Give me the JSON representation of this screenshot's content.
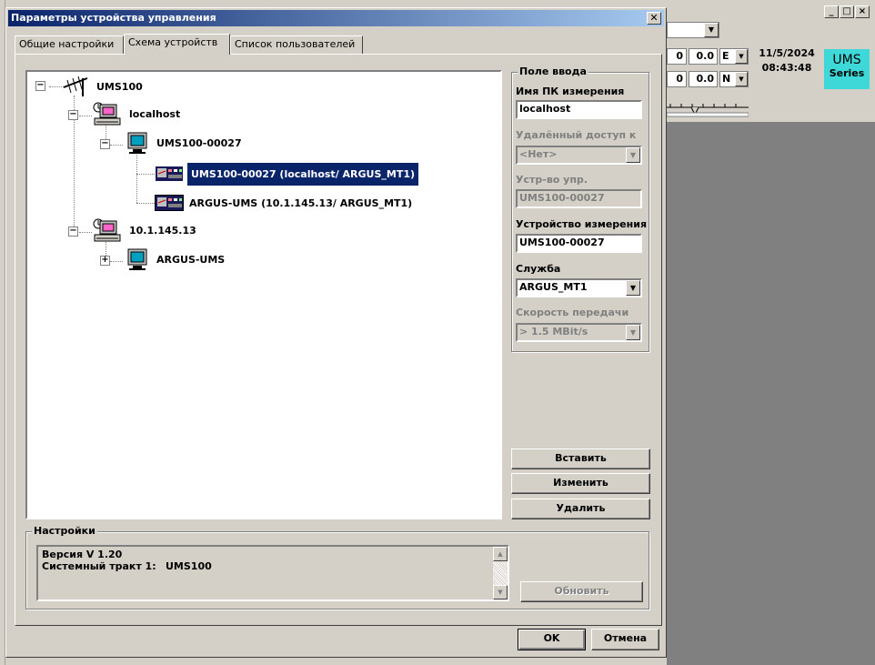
{
  "dialog": {
    "title": "Параметры устройства управления",
    "close_glyph": "✕"
  },
  "tabs": [
    {
      "label": "Общие настройки"
    },
    {
      "label": "Схема устройств"
    },
    {
      "label": "Список пользователей"
    }
  ],
  "tree": {
    "root": "UMS100",
    "host1": "localhost",
    "device1": "UMS100-00027",
    "service1": "UMS100-00027 (localhost/ ARGUS_MT1)",
    "service2": "ARGUS-UMS (10.1.145.13/ ARGUS_MT1)",
    "host2": "10.1.145.13",
    "device2": "ARGUS-UMS",
    "collapse_glyph": "−",
    "expand_glyph": "+"
  },
  "input_group": {
    "legend": "Поле ввода",
    "pc_name_label": "Имя ПК измерения",
    "pc_name_value": "localhost",
    "remote_label": "Удалённый доступ к",
    "remote_value": "<Нет>",
    "control_dev_label": "Устр-во упр.",
    "control_dev_value": "UMS100-00027",
    "meas_dev_label": "Устройство измерения",
    "meas_dev_value": "UMS100-00027",
    "service_label": "Служба",
    "service_value": "ARGUS_MT1",
    "speed_label": "Скорость передачи",
    "speed_value": "> 1.5 MBit/s"
  },
  "buttons": {
    "insert": "Вставить",
    "change": "Изменить",
    "delete": "Удалить",
    "refresh": "Обновить",
    "ok": "OK",
    "cancel": "Отмена"
  },
  "settings": {
    "legend": "Настройки",
    "version_line": "Версия V 1.20",
    "path_label": "Системный тракт 1:",
    "path_value": "UMS100"
  },
  "background_app": {
    "field1": "0",
    "field2": "0.0",
    "dir1": "E",
    "field3": "0",
    "field4": "0.0",
    "dir2": "N",
    "date": "11/5/2024",
    "time": "08:43:48",
    "logo_line1": "UMS",
    "logo_line2": "Series",
    "logo_color": "#3fd8d8"
  },
  "colors": {
    "title_start": "#0a246a",
    "selection": "#0a246a",
    "face": "#d4d0c8"
  },
  "icons": [
    "antenna-icon",
    "network-computer-icon",
    "monitor-icon",
    "device-service-icon"
  ]
}
